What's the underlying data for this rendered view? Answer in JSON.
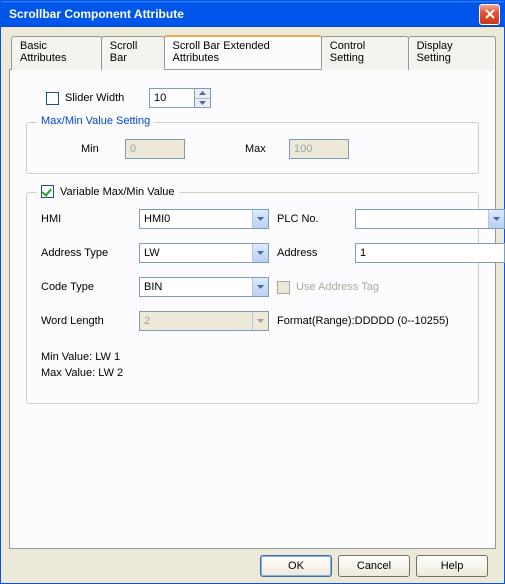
{
  "window": {
    "title": "Scrollbar Component Attribute"
  },
  "tabs": {
    "basic": "Basic Attributes",
    "scrollbar": "Scroll Bar",
    "extended": "Scroll Bar Extended Attributes",
    "control": "Control Setting",
    "display": "Display Setting"
  },
  "slider": {
    "checkbox_label": "Slider Width",
    "value": "10"
  },
  "maxmin": {
    "legend": "Max/Min Value Setting",
    "min_label": "Min",
    "min_value": "0",
    "max_label": "Max",
    "max_value": "100"
  },
  "variable": {
    "legend": "Variable Max/Min Value",
    "hmi_label": "HMI",
    "hmi_value": "HMI0",
    "plcno_label": "PLC No.",
    "plcno_value": "",
    "addrtype_label": "Address Type",
    "addrtype_value": "LW",
    "address_label": "Address",
    "address_value": "1",
    "codetype_label": "Code Type",
    "codetype_value": "BIN",
    "useaddrtag_label": "Use Address Tag",
    "wordlen_label": "Word Length",
    "wordlen_value": "2",
    "format_label": "Format(Range):DDDDD (0--10255)",
    "note_min": "Min Value: LW 1",
    "note_max": "Max Value: LW 2"
  },
  "buttons": {
    "ok": "OK",
    "cancel": "Cancel",
    "help": "Help"
  }
}
